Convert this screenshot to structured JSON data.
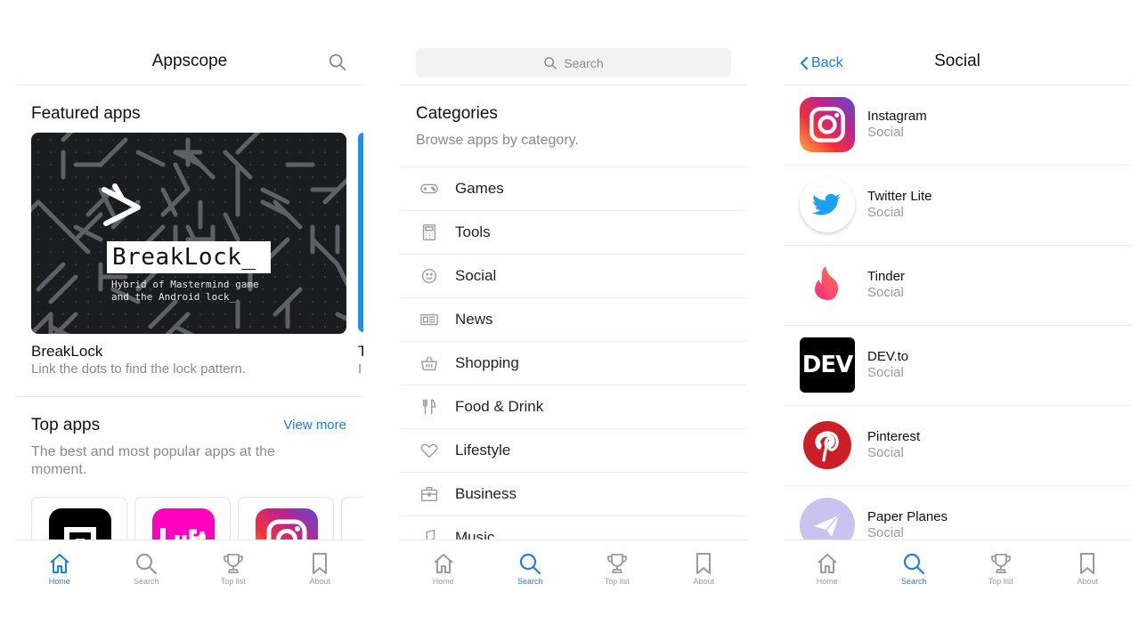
{
  "nav": [
    {
      "label": "Home",
      "icon": "home-icon"
    },
    {
      "label": "Search",
      "icon": "search-icon"
    },
    {
      "label": "Top list",
      "icon": "trophy-icon"
    },
    {
      "label": "About",
      "icon": "bookmark-icon"
    }
  ],
  "colors": {
    "accent": "#1a7fe8",
    "muted": "#9a9a9a"
  },
  "home": {
    "title": "Appscope",
    "featured_title": "Featured apps",
    "featured": {
      "logo": "BreakLock_",
      "tagline": "Hybrid of Mastermind game\nand the Android lock_",
      "name": "BreakLock",
      "description": "Link the dots to find the lock pattern.",
      "next_name": "T",
      "next_desc": "I"
    },
    "top_title": "Top apps",
    "view_more": "View more",
    "top_subtitle": "The best and most popular apps at the moment.",
    "top_apps": [
      {
        "icon": "uber-icon"
      },
      {
        "icon": "lyft-icon"
      },
      {
        "icon": "instagram-icon"
      }
    ],
    "active_nav": "Home"
  },
  "search": {
    "placeholder": "Search",
    "categories_title": "Categories",
    "categories_subtitle": "Browse apps by category.",
    "categories": [
      {
        "label": "Games",
        "icon": "gamepad-icon"
      },
      {
        "label": "Tools",
        "icon": "calculator-icon"
      },
      {
        "label": "Social",
        "icon": "smiley-icon"
      },
      {
        "label": "News",
        "icon": "newspaper-icon"
      },
      {
        "label": "Shopping",
        "icon": "basket-icon"
      },
      {
        "label": "Food & Drink",
        "icon": "cutlery-icon"
      },
      {
        "label": "Lifestyle",
        "icon": "heart-icon"
      },
      {
        "label": "Business",
        "icon": "briefcase-icon"
      },
      {
        "label": "Music",
        "icon": "music-note-icon"
      }
    ],
    "active_nav": "Search"
  },
  "social": {
    "back": "Back",
    "title": "Social",
    "apps": [
      {
        "name": "Instagram",
        "category": "Social",
        "icon": "instagram-icon"
      },
      {
        "name": "Twitter Lite",
        "category": "Social",
        "icon": "twitter-icon"
      },
      {
        "name": "Tinder",
        "category": "Social",
        "icon": "tinder-icon"
      },
      {
        "name": "DEV.to",
        "category": "Social",
        "icon": "dev-icon",
        "icon_text": "DEV"
      },
      {
        "name": "Pinterest",
        "category": "Social",
        "icon": "pinterest-icon"
      },
      {
        "name": "Paper Planes",
        "category": "Social",
        "icon": "paper-plane-icon"
      }
    ],
    "active_nav": "Search"
  }
}
